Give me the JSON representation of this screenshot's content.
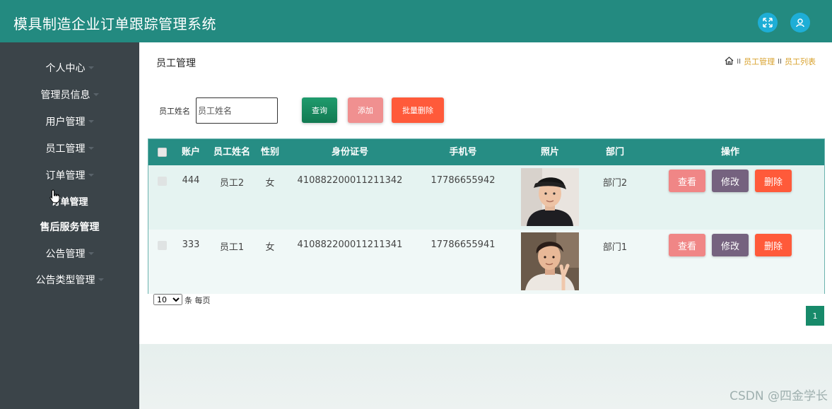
{
  "app": {
    "title": "模具制造企业订单跟踪管理系统"
  },
  "topbar_icons": [
    "fullscreen-icon",
    "user-icon"
  ],
  "sidebar": {
    "items": [
      {
        "label": "个人中心",
        "caret": true,
        "bold": false
      },
      {
        "label": "管理员信息",
        "caret": true,
        "bold": false
      },
      {
        "label": "用户管理",
        "caret": true,
        "bold": false
      },
      {
        "label": "员工管理",
        "caret": true,
        "bold": false
      },
      {
        "label": "订单管理",
        "caret": true,
        "bold": false
      },
      {
        "label": "订单管理",
        "caret": false,
        "bold": true
      },
      {
        "label": "售后服务管理",
        "caret": false,
        "bold": true
      },
      {
        "label": "公告管理",
        "caret": true,
        "bold": false
      },
      {
        "label": "公告类型管理",
        "caret": true,
        "bold": false
      }
    ]
  },
  "page": {
    "title": "员工管理",
    "breadcrumb": {
      "sep": "II",
      "items": [
        "员工管理",
        "员工列表"
      ]
    }
  },
  "search": {
    "label": "员工姓名",
    "placeholder": "员工姓名",
    "value": ""
  },
  "toolbar": {
    "query_label": "查询",
    "add_label": "添加",
    "batch_delete_label": "批量删除"
  },
  "table": {
    "headers": [
      "账户",
      "员工姓名",
      "性别",
      "身份证号",
      "手机号",
      "照片",
      "部门",
      "操作"
    ],
    "rows": [
      {
        "account": "444",
        "name": "员工2",
        "gender": "女",
        "id_number": "410882200011211342",
        "phone": "17786655942",
        "department": "部门2"
      },
      {
        "account": "333",
        "name": "员工1",
        "gender": "女",
        "id_number": "410882200011211341",
        "phone": "17786655941",
        "department": "部门1"
      }
    ],
    "actions": {
      "view": "查看",
      "edit": "修改",
      "delete": "删除"
    }
  },
  "pagination": {
    "page_size": "10",
    "page_size_suffix": "条 每页",
    "current_page": "1"
  },
  "watermark": "CSDN @四金学长",
  "colors": {
    "header": "#238a80",
    "sidebar": "#3b4449",
    "accent_orange": "#ff5a3a",
    "accent_pink": "#f09090",
    "accent_purple": "#75627f"
  }
}
